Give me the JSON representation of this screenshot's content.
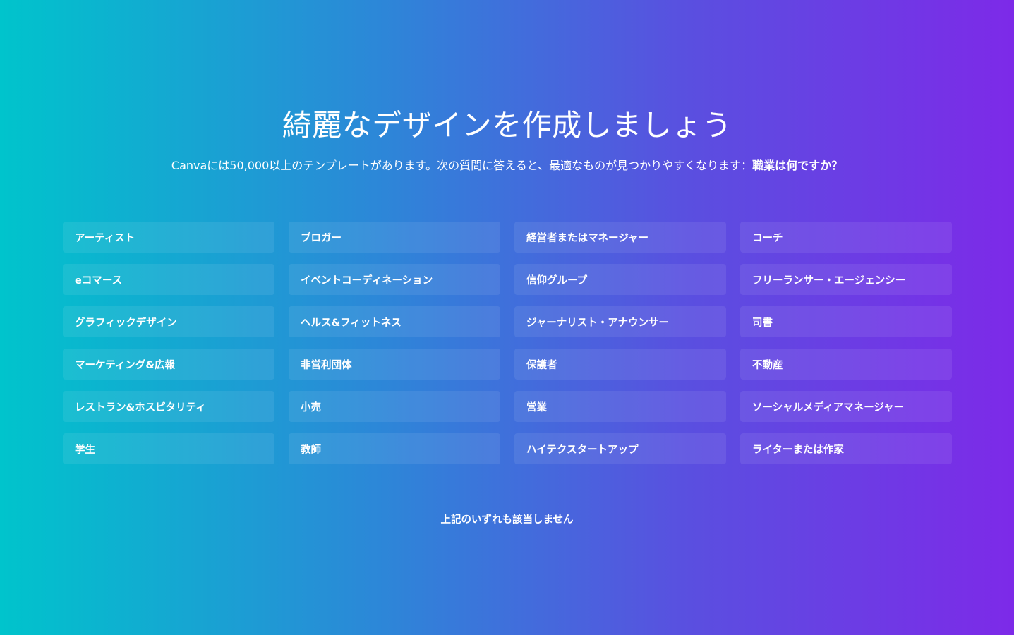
{
  "page": {
    "title": "綺麗なデザインを作成しましょう",
    "subtitle_text": "Canvaには50,000以上のテンプレートがあります。次の質問に答えると、最適なものが見つかりやすくなります：",
    "subtitle_question": "職業は何ですか？",
    "none_option": "上記のいずれも該当しません"
  },
  "occupations": [
    "アーティスト",
    "ブロガー",
    "経営者またはマネージャー",
    "コーチ",
    "eコマース",
    "イベントコーディネーション",
    "信仰グループ",
    "フリーランサー・エージェンシー",
    "グラフィックデザイン",
    "ヘルス&フィットネス",
    "ジャーナリスト・アナウンサー",
    "司書",
    "マーケティング&広報",
    "非営利団体",
    "保護者",
    "不動産",
    "レストラン&ホスピタリティ",
    "小売",
    "営業",
    "ソーシャルメディアマネージャー",
    "学生",
    "教師",
    "ハイテクスタートアップ",
    "ライターまたは作家"
  ],
  "colors": {
    "gradient_start": "#00c4cc",
    "gradient_end": "#7d2ae8",
    "text": "#ffffff"
  }
}
